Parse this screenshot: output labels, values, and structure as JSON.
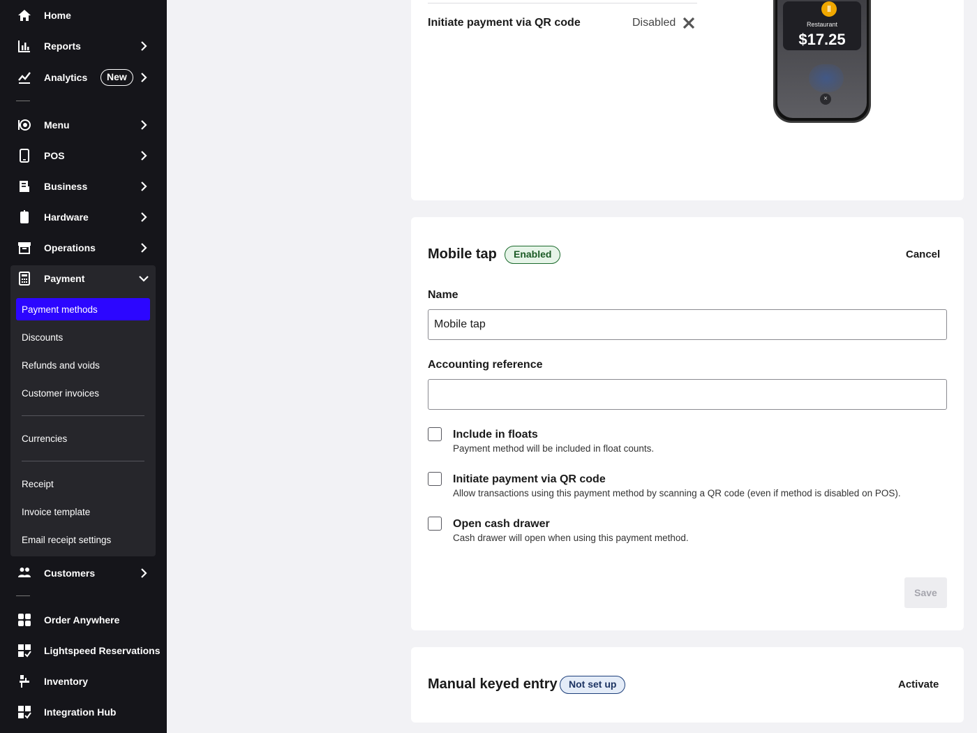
{
  "sidebar": {
    "items": [
      {
        "label": "Home",
        "icon": "home-icon"
      },
      {
        "label": "Reports",
        "icon": "bar-chart-icon"
      },
      {
        "label": "Analytics",
        "icon": "trend-icon",
        "badge": "New"
      },
      {
        "label": "Menu",
        "icon": "menu-dish-icon"
      },
      {
        "label": "POS",
        "icon": "tablet-icon"
      },
      {
        "label": "Business",
        "icon": "business-icon"
      },
      {
        "label": "Hardware",
        "icon": "hardware-icon"
      },
      {
        "label": "Operations",
        "icon": "archive-icon"
      },
      {
        "label": "Payment",
        "icon": "calculator-icon"
      },
      {
        "label": "Customers",
        "icon": "people-icon"
      },
      {
        "label": "Order Anywhere",
        "icon": "grid-icon"
      },
      {
        "label": "Lightspeed Reservations",
        "icon": "apps-check-icon"
      },
      {
        "label": "Inventory",
        "icon": "inventory-icon"
      },
      {
        "label": "Integration Hub",
        "icon": "apps-check-icon"
      }
    ],
    "payment_sub": [
      {
        "label": "Payment methods",
        "active": true
      },
      {
        "label": "Discounts"
      },
      {
        "label": "Refunds and voids"
      },
      {
        "label": "Customer invoices"
      },
      {
        "label": "Currencies"
      },
      {
        "label": "Receipt"
      },
      {
        "label": "Invoice template"
      },
      {
        "label": "Email receipt settings"
      }
    ]
  },
  "top_card": {
    "qr_label": "Initiate payment via QR code",
    "qr_status": "Disabled",
    "phone": {
      "merchant": "Restaurant",
      "amount": "$17.25"
    }
  },
  "mobile_tap": {
    "title": "Mobile tap",
    "status": "Enabled",
    "cancel": "Cancel",
    "name_label": "Name",
    "name_value": "Mobile tap",
    "accounting_label": "Accounting reference",
    "accounting_value": "",
    "options": [
      {
        "title": "Include in floats",
        "desc": "Payment method will be included in float counts.",
        "checked": false
      },
      {
        "title": "Initiate payment via QR code",
        "desc": "Allow transactions using this payment method by scanning a QR code (even if method is disabled on POS).",
        "checked": false
      },
      {
        "title": "Open cash drawer",
        "desc": "Cash drawer will open when using this payment method.",
        "checked": false
      }
    ],
    "save": "Save"
  },
  "manual_entry": {
    "title": "Manual keyed entry",
    "status": "Not set up",
    "activate": "Activate"
  },
  "colors": {
    "sidebar_bg": "#15151a",
    "active_item": "#2c06ff",
    "enabled_green": "#1b6a2c",
    "notset_blue": "#1d3f7a"
  }
}
